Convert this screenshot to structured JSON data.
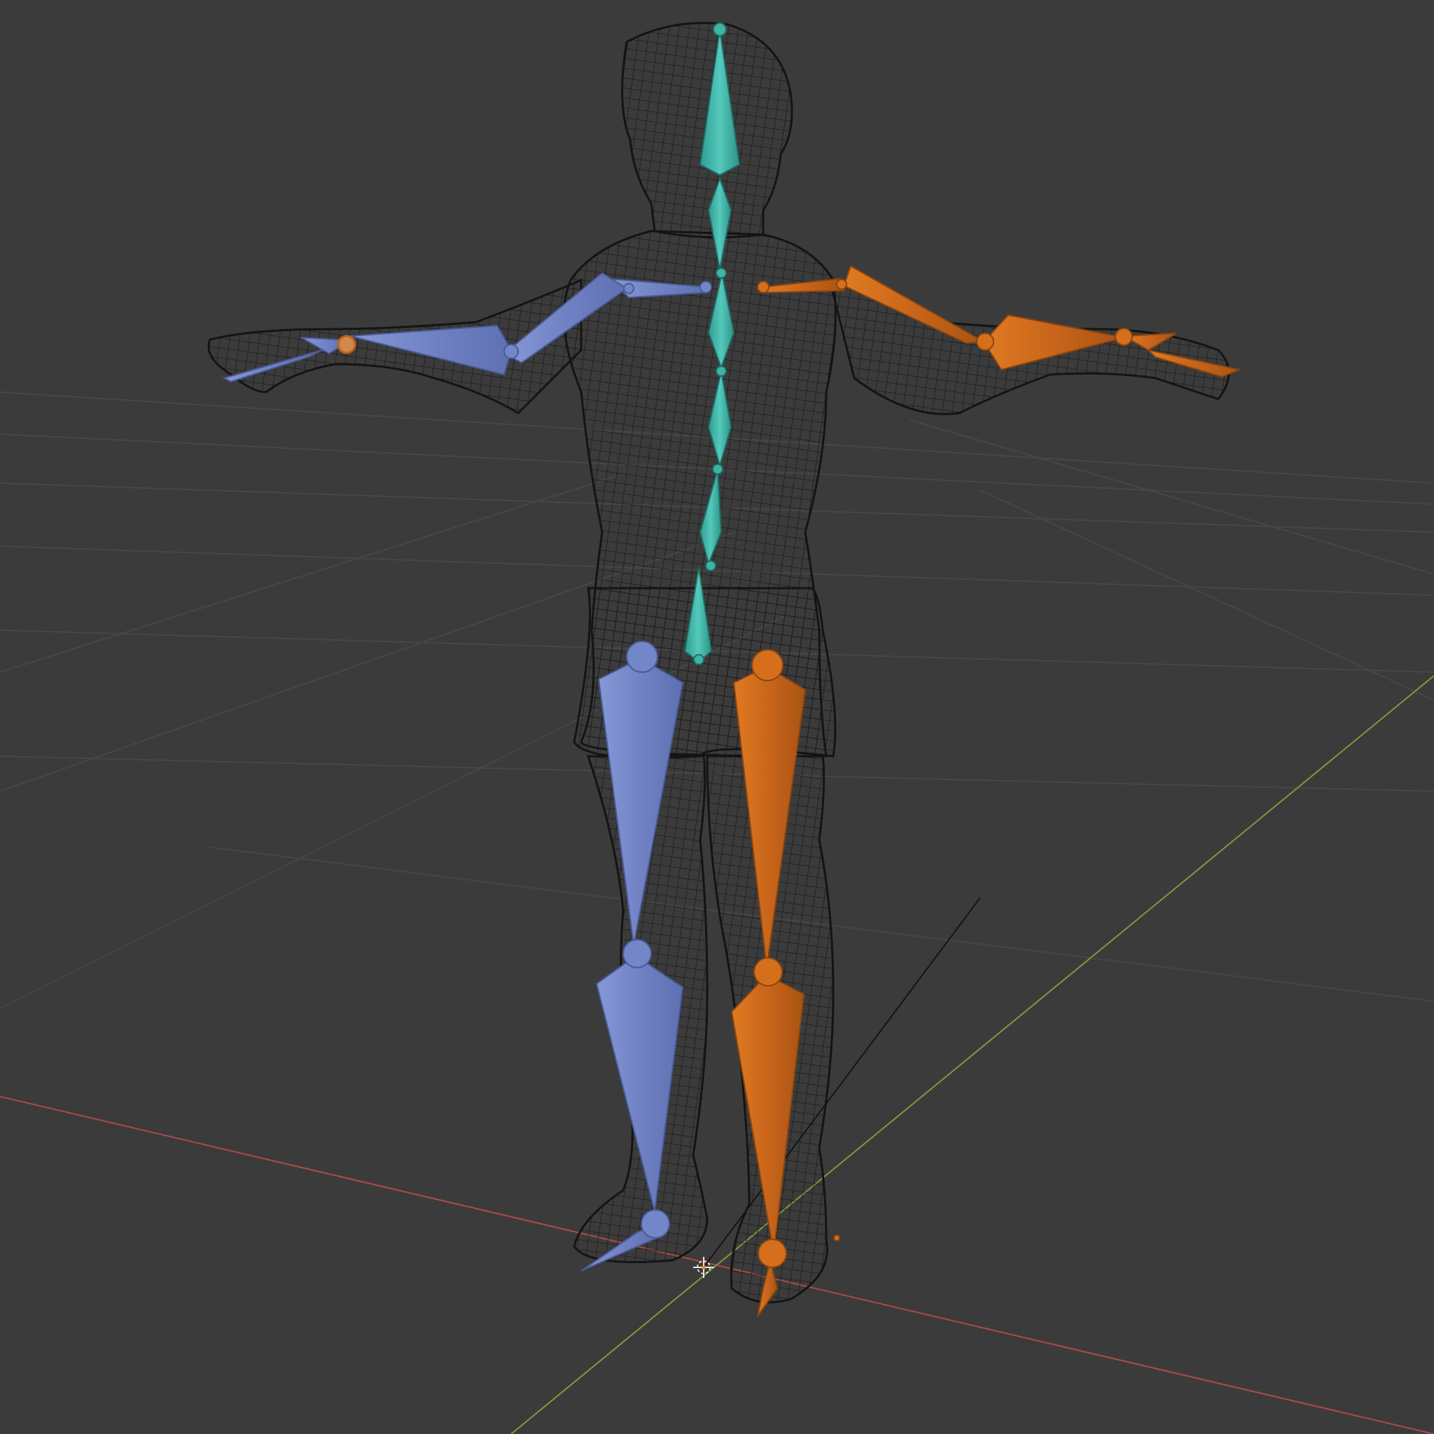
{
  "viewport": {
    "background": "#3b3b3b",
    "grid_color": "#4a4a4a",
    "x_axis_color": "#b04848",
    "y_axis_color": "#7d9a3a",
    "mesh_color": "#141414"
  },
  "armature": {
    "center_color": "#3fb3a6",
    "left_color": "#7286c8",
    "right_color": "#d66f1c",
    "bones_center": [
      "head",
      "neck",
      "spine-upper",
      "spine-mid",
      "spine-lower",
      "hips"
    ],
    "bones_left": [
      "left-shoulder",
      "left-upper-arm",
      "left-forearm",
      "left-hand",
      "left-thigh",
      "left-shin",
      "left-foot"
    ],
    "bones_right": [
      "right-shoulder",
      "right-upper-arm",
      "right-forearm",
      "right-hand",
      "right-thigh",
      "right-shin",
      "right-foot"
    ]
  },
  "icons": {
    "origin": "3d-cursor-icon"
  }
}
